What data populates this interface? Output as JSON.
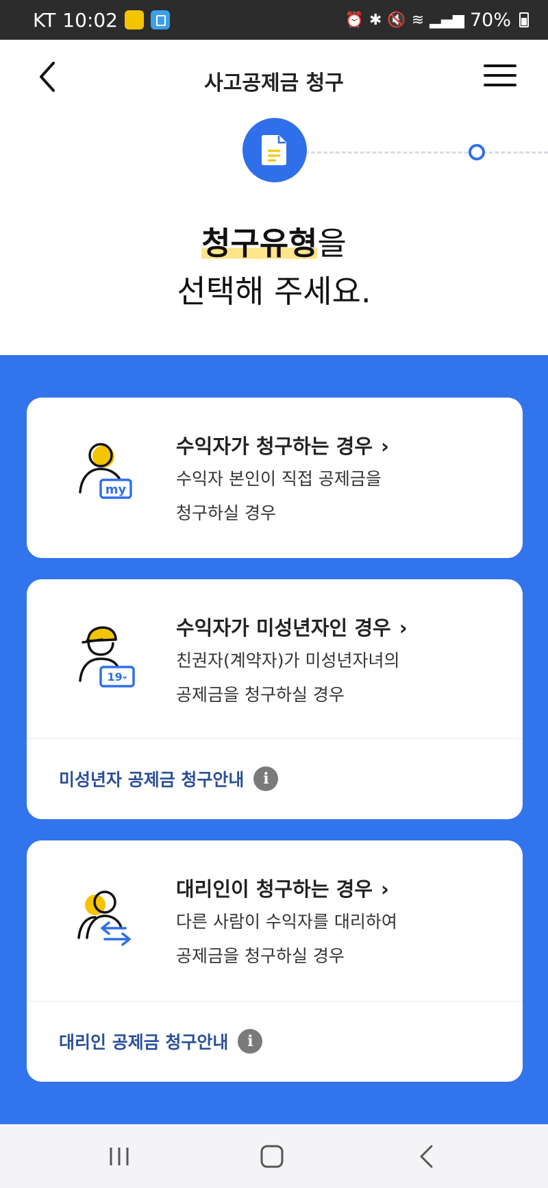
{
  "status_bar": {
    "carrier": "KT",
    "time": "10:02",
    "battery": "70%"
  },
  "header": {
    "title": "사고공제금 청구"
  },
  "heading": {
    "highlight": "청구유형",
    "line1_suffix": "을",
    "line2": "선택해 주세요."
  },
  "cards": [
    {
      "title": "수익자가 청구하는 경우",
      "desc_line1": "수익자 본인이 직접 공제금을",
      "desc_line2": "청구하실 경우",
      "badge": "my"
    },
    {
      "title": "수익자가 미성년자인 경우",
      "desc_line1": "친권자(계약자)가 미성년자녀의",
      "desc_line2": "공제금을 청구하실 경우",
      "badge": "19-",
      "footer_link": "미성년자 공제금 청구안내"
    },
    {
      "title": "대리인이 청구하는 경우",
      "desc_line1": "다른 사람이 수익자를 대리하여",
      "desc_line2": "공제금을 청구하실 경우",
      "footer_link": "대리인 공제금 청구안내"
    }
  ],
  "colors": {
    "primary_blue": "#3274ec",
    "highlight_yellow": "#ffe58a",
    "icon_yellow": "#f5c400",
    "link_blue": "#2a4f9a"
  },
  "icons": {
    "back": "chevron-left-icon",
    "menu": "hamburger-menu-icon",
    "step": "document-icon",
    "chevron": "chevron-right-icon",
    "info": "info-icon"
  }
}
